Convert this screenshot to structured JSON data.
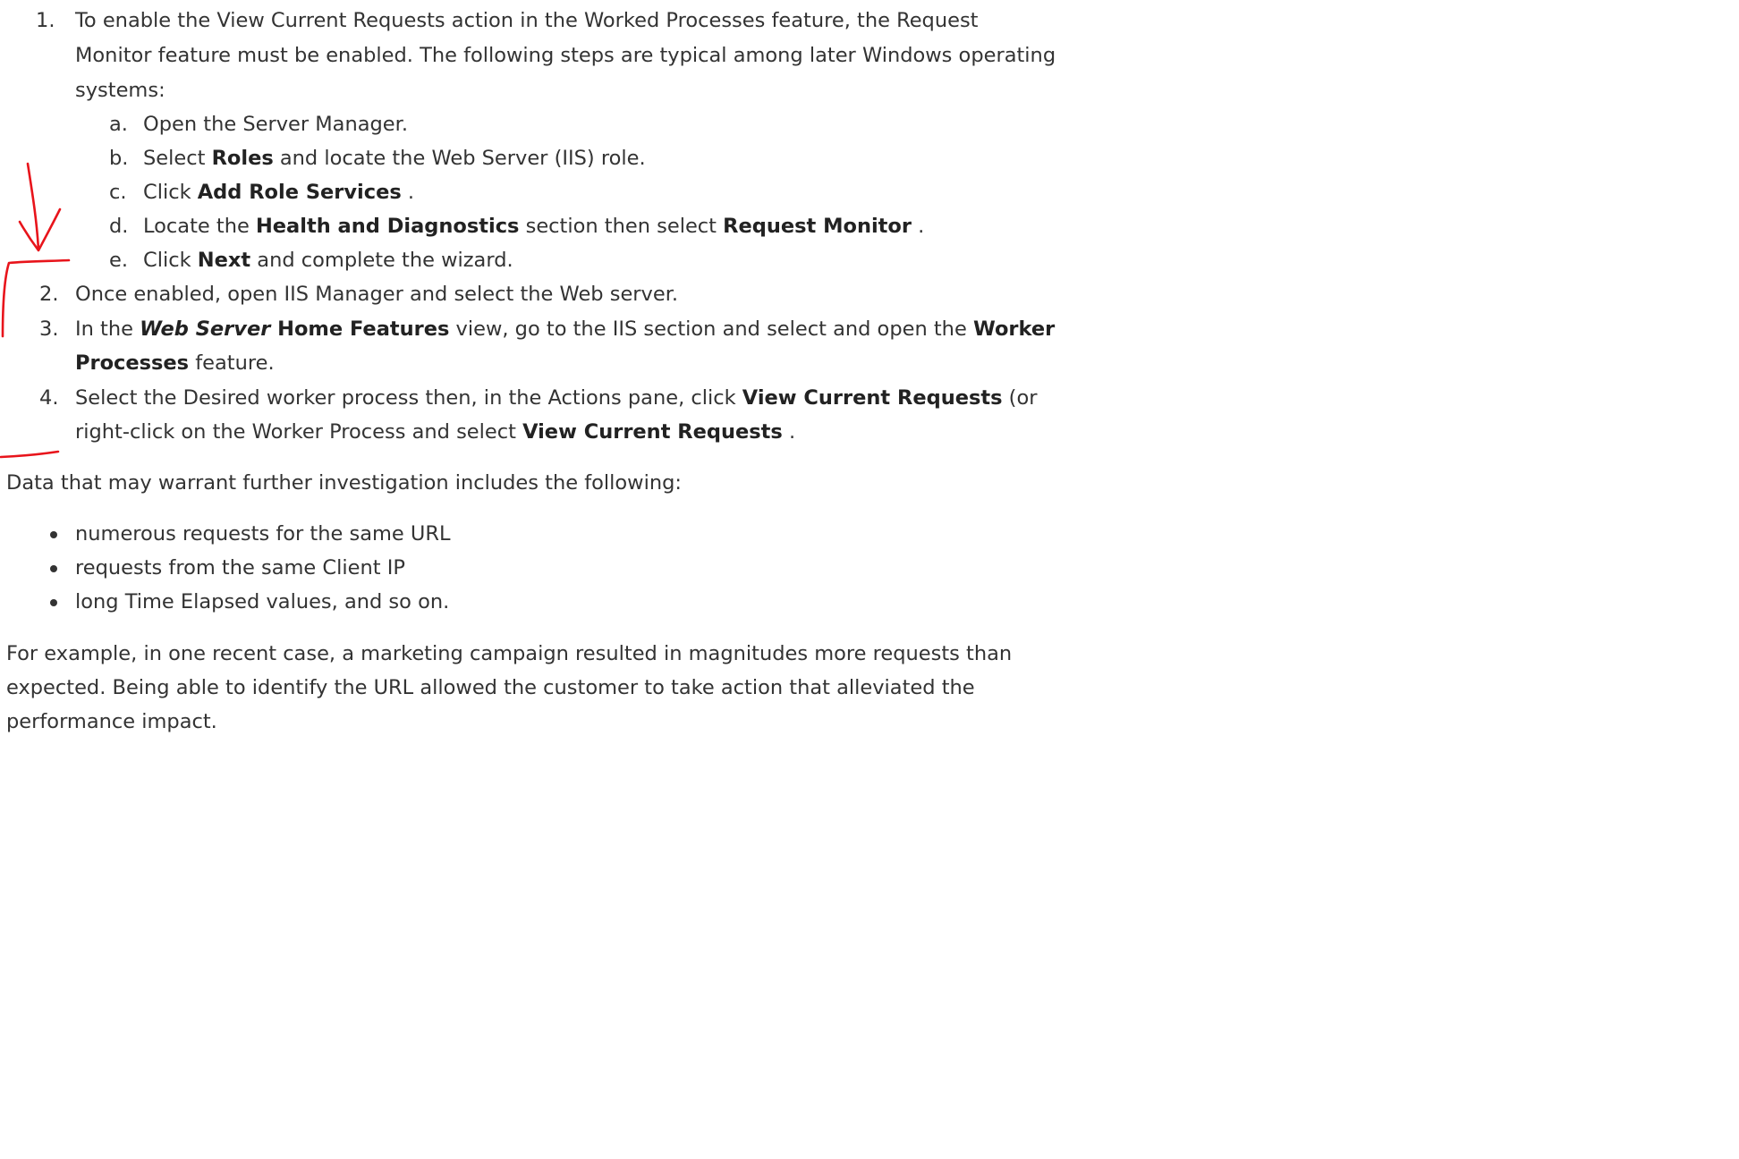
{
  "steps": [
    {
      "marker": "1.",
      "text_line1": "To enable the View Current Requests action in the Worked Processes feature, the Request",
      "text_line2": "Monitor feature must be enabled. The following steps are typical among later Windows operating",
      "text_line3": "systems:",
      "substeps": [
        {
          "marker": "a.",
          "text": "Open the Server Manager."
        },
        {
          "marker": "b.",
          "pre": "Select ",
          "bold1": "Roles",
          "post": " and locate the Web Server (IIS) role."
        },
        {
          "marker": "c.",
          "pre": "Click ",
          "bold1": "Add Role Services",
          "post": " ."
        },
        {
          "marker": "d.",
          "pre": "Locate the ",
          "bold1": "Health and Diagnostics",
          "mid": " section then select ",
          "bold2": "Request Monitor",
          "post": " ."
        },
        {
          "marker": "e.",
          "pre": "Click ",
          "bold1": "Next",
          "post": " and complete the wizard."
        }
      ]
    },
    {
      "marker": "2.",
      "text": "Once enabled, open IIS Manager and select the Web server."
    },
    {
      "marker": "3.",
      "pre": "In the ",
      "bold_italic": "Web Server",
      "bold1": " Home Features",
      "mid": " view, go to the IIS section and select and open the ",
      "bold2": "Worker",
      "line2_bold": "Processes",
      "line2_post": " feature."
    },
    {
      "marker": "4.",
      "pre": "Select the Desired worker process then, in the Actions pane, click ",
      "bold1": "View Current Requests",
      "post": " (or",
      "line2_pre": "right-click on the Worker Process and select ",
      "line2_bold": "View Current Requests",
      "line2_post": " ."
    }
  ],
  "investigation_intro": "Data that may warrant further investigation includes the following:",
  "investigation_items": [
    "numerous requests for the same URL",
    "requests from the same Client IP",
    "long Time Elapsed values, and so on."
  ],
  "example_para": {
    "line1": "For example, in one recent case, a marketing campaign resulted in magnitudes more requests than",
    "line2": "expected. Being able to identify the URL allowed the customer to take action that alleviated the",
    "line3": "performance impact."
  },
  "annotation_color": "#e8141b"
}
